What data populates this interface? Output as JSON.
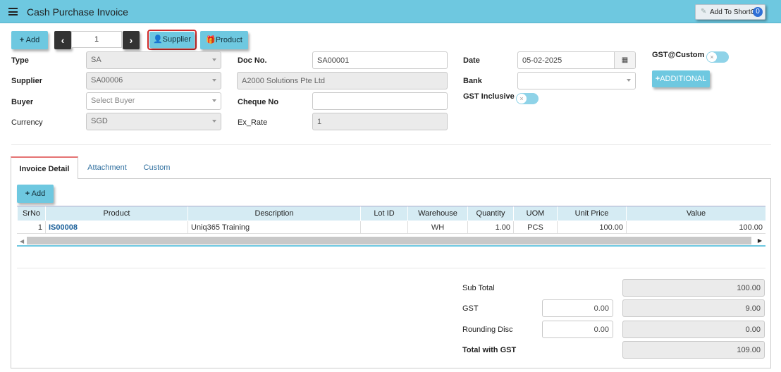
{
  "header": {
    "title": "Cash Purchase Invoice",
    "shortcut_label": "Add To ShortCut",
    "shortcut_count": "0"
  },
  "toolbar": {
    "add_label": "Add",
    "prev_glyph": "‹",
    "next_glyph": "›",
    "record_number": "1",
    "supplier_label": "Supplier",
    "product_label": "Product"
  },
  "form": {
    "type": {
      "label": "Type",
      "value": "SA"
    },
    "supplier": {
      "label": "Supplier",
      "value": "SA00006"
    },
    "buyer": {
      "label": "Buyer",
      "placeholder": "Select Buyer"
    },
    "currency": {
      "label": "Currency",
      "value": "SGD"
    },
    "doc_no": {
      "label": "Doc No.",
      "value": "SA00001"
    },
    "supplier_name": {
      "value": "A2000 Solutions Pte Ltd"
    },
    "cheque_no": {
      "label": "Cheque No",
      "value": ""
    },
    "ex_rate": {
      "label": "Ex_Rate",
      "value": "1"
    },
    "date": {
      "label": "Date",
      "value": "05-02-2025"
    },
    "bank": {
      "label": "Bank",
      "value": ""
    },
    "gst_inclusive": {
      "label": "GST Inclusive",
      "on": false
    },
    "gst_custom": {
      "label": "GST@Custom",
      "on": false
    },
    "additional_label": "ADDITIONAL"
  },
  "tabs": [
    {
      "label": "Invoice Detail",
      "active": true
    },
    {
      "label": "Attachment",
      "active": false
    },
    {
      "label": "Custom",
      "active": false
    }
  ],
  "detail": {
    "add_label": "Add",
    "columns": [
      "SrNo",
      "Product",
      "Description",
      "Lot ID",
      "Warehouse",
      "Quantity",
      "UOM",
      "Unit Price",
      "Value"
    ],
    "rows": [
      {
        "srno": "1",
        "product": "IS00008",
        "description": "Uniq365 Training",
        "lot_id": "",
        "warehouse": "WH",
        "quantity": "1.00",
        "uom": "PCS",
        "unit_price": "100.00",
        "value": "100.00"
      }
    ]
  },
  "totals": {
    "sub_total": {
      "label": "Sub Total",
      "value": "100.00"
    },
    "gst": {
      "label": "GST",
      "rate": "0.00",
      "value": "9.00"
    },
    "rounding": {
      "label": "Rounding Disc",
      "input": "0.00",
      "value": "0.00"
    },
    "total_gst": {
      "label": "Total with GST",
      "value": "109.00"
    }
  },
  "colors": {
    "accent": "#6ec8e0",
    "highlight_border": "#d02a2a",
    "link": "#1a5f99",
    "tab_active_border": "#e57373"
  }
}
